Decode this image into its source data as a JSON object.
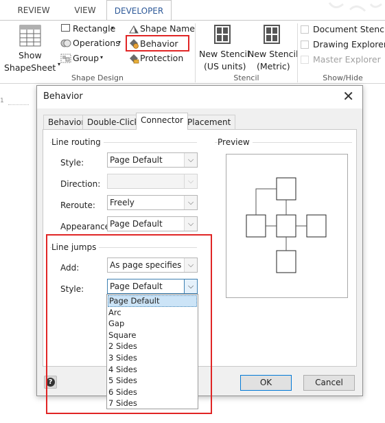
{
  "ribbon": {
    "tabs": [
      "REVIEW",
      "VIEW",
      "DEVELOPER"
    ],
    "active_tab": "DEVELOPER",
    "shape_design": {
      "show_shapesheet": [
        "Show",
        "ShapeSheet"
      ],
      "rectangle": "Rectangle",
      "operations": "Operations",
      "group": "Group",
      "shape_name": "Shape Name",
      "behavior": "Behavior",
      "protection": "Protection",
      "label": "Shape Design"
    },
    "stencil": {
      "new_us": [
        "New Stencil",
        "(US units)"
      ],
      "new_metric": [
        "New Stencil",
        "(Metric)"
      ],
      "label": "Stencil"
    },
    "show_hide": {
      "document_stencil": "Document Stencil",
      "drawing_explorer": "Drawing Explorer",
      "master_explorer": "Master Explorer",
      "label": "Show/Hide"
    }
  },
  "ruler_mark": "1",
  "dialog": {
    "title": "Behavior",
    "close": "✕",
    "tabs": [
      "Behavior",
      "Double-Click",
      "Connector",
      "Placement"
    ],
    "active_tab": "Connector",
    "line_routing": {
      "title": "Line routing",
      "style_label": "Style:",
      "style_value": "Page Default",
      "direction_label": "Direction:",
      "direction_value": "",
      "reroute_label": "Reroute:",
      "reroute_value": "Freely",
      "appearance_label": "Appearance:",
      "appearance_value": "Page Default"
    },
    "preview_title": "Preview",
    "line_jumps": {
      "title": "Line jumps",
      "add_label": "Add:",
      "add_value": "As page specifies",
      "style_label": "Style:",
      "style_value": "Page Default",
      "options": [
        "Page Default",
        "Arc",
        "Gap",
        "Square",
        "2 Sides",
        "3 Sides",
        "4 Sides",
        "5 Sides",
        "6 Sides",
        "7 Sides"
      ],
      "selected_option": "Page Default"
    },
    "ok": "OK",
    "cancel": "Cancel",
    "help": "?"
  },
  "colors": {
    "annotation_red": "#e02424",
    "tab_active_text": "#2b5797",
    "dropdown_highlight": "#cce4f7"
  }
}
